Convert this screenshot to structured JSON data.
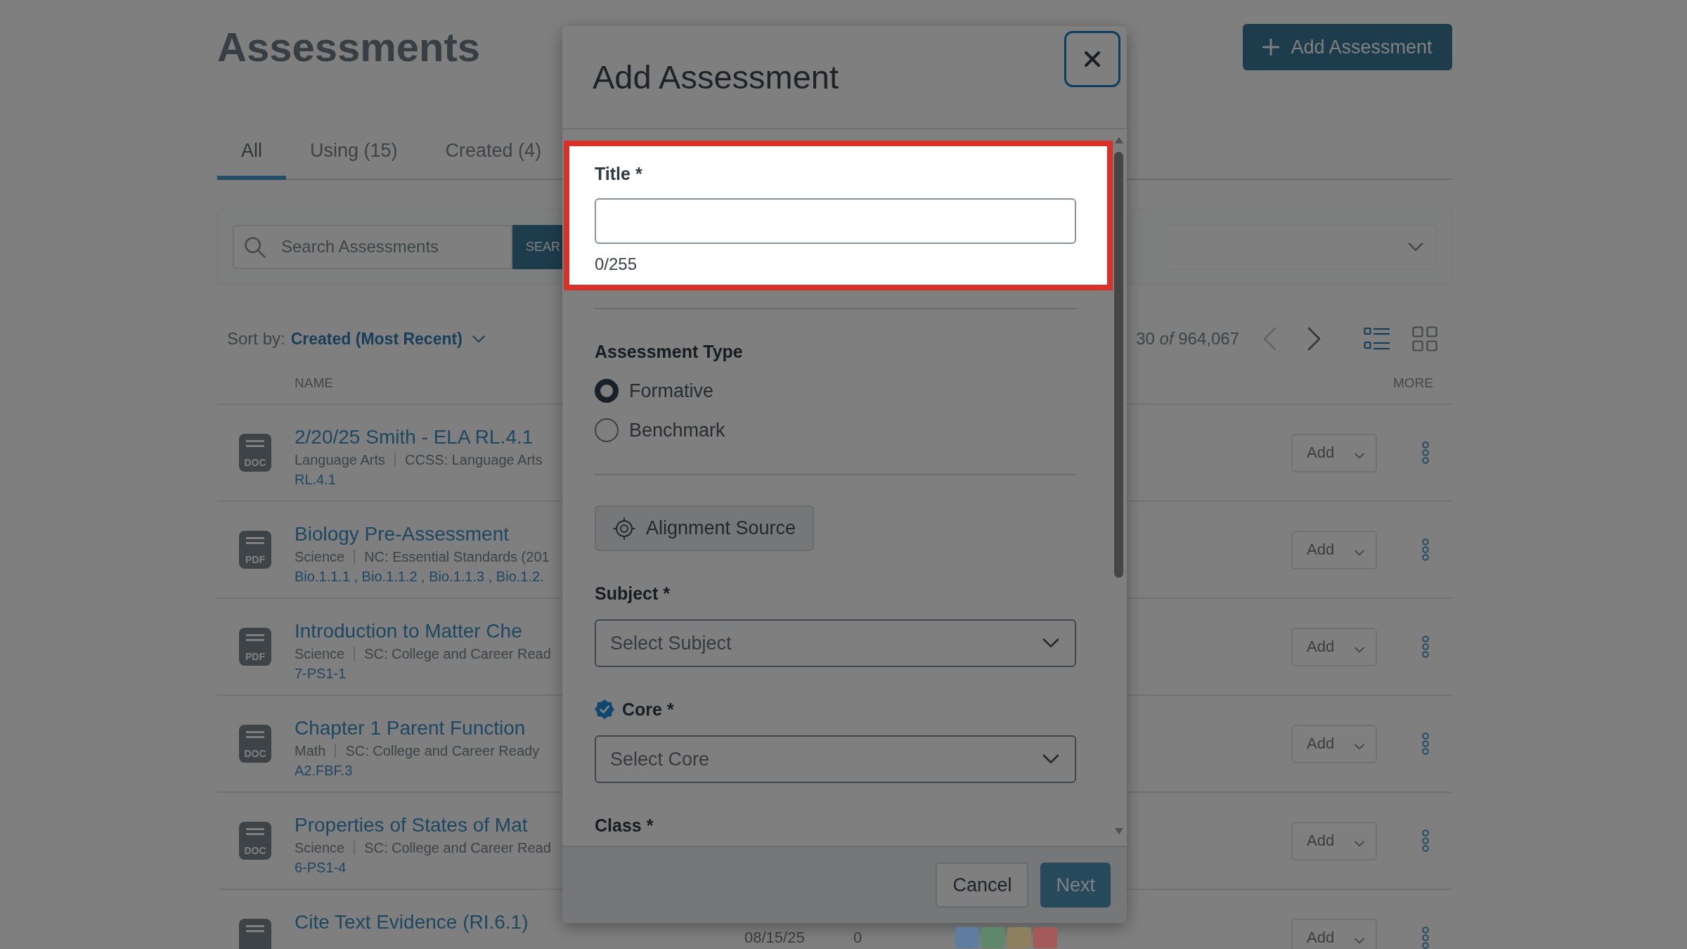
{
  "page": {
    "title": "Assessments",
    "add_button": "Add Assessment",
    "tabs": [
      {
        "label": "All",
        "selected": true
      },
      {
        "label": "Using (15)",
        "selected": false
      },
      {
        "label": "Created (4)",
        "selected": false
      }
    ],
    "search": {
      "placeholder": "Search Assessments",
      "button": "SEAR"
    },
    "sort": {
      "label": "Sort by:",
      "value": "Created (Most Recent)"
    },
    "pagination": {
      "range": "30 *of* 964,067",
      "previous": {
        "disabled": true
      },
      "next": {
        "disabled": false
      }
    },
    "views": [
      {
        "kind": "list",
        "selected": true
      },
      {
        "kind": "grid",
        "selected": false
      }
    ],
    "columns": [
      "NAME",
      "MORE"
    ],
    "rows": [
      {
        "file_type": "DOC",
        "title": "2/20/25 Smith - ELA RL.4.1",
        "subject": "Language Arts",
        "standard": "CCSS: Language Arts",
        "codes": "RL.4.1",
        "action": "Add"
      },
      {
        "file_type": "PDF",
        "title": "Biology Pre-Assessment",
        "subject": "Science",
        "standard": "NC: Essential Standards (201",
        "codes": "Bio.1.1.1 , Bio.1.1.2 , Bio.1.1.3 , Bio.1.2.",
        "action": "Add"
      },
      {
        "file_type": "PDF",
        "title": "Introduction to Matter Che",
        "subject": "Science",
        "standard": "SC: College and Career Read",
        "codes": "7-PS1-1",
        "action": "Add"
      },
      {
        "file_type": "DOC",
        "title": "Chapter 1 Parent Function",
        "subject": "Math",
        "standard": "SC: College and Career Ready",
        "codes": "A2.FBF.3",
        "action": "Add"
      },
      {
        "file_type": "DOC",
        "title": "Properties of States of Mat",
        "subject": "Science",
        "standard": "SC: College and Career Read",
        "codes": "6-PS1-4",
        "action": "Add"
      },
      {
        "title": "Cite Text Evidence (RI.6.1)",
        "date": "08/15/25",
        "count": "0",
        "tags": [
          {
            "color": "#5f7da0"
          },
          {
            "color": "#5f8769"
          },
          {
            "color": "#8c805f"
          },
          {
            "color": "#a55a5a"
          }
        ],
        "action": "Add"
      }
    ]
  },
  "dialog": {
    "title": "Add Assessment",
    "fields": [
      {
        "kind": "text",
        "label": "Title *",
        "counter": "0/255",
        "highlighted": true,
        "divider": true
      },
      {
        "kind": "radio",
        "label": "Assessment Type",
        "options": [
          {
            "label": "Formative",
            "selected": true
          },
          {
            "label": "Benchmark",
            "selected": false
          }
        ],
        "highlighted": false,
        "divider": true
      },
      {
        "kind": "button",
        "label": "Alignment Source",
        "highlighted": false,
        "divider": false
      },
      {
        "kind": "select",
        "label": "Subject *",
        "placeholder": "Select Subject",
        "verified": false,
        "highlighted": false,
        "divider": false
      },
      {
        "kind": "select",
        "label": "Core *",
        "placeholder": "Select Core",
        "verified": true,
        "highlighted": false,
        "divider": false
      },
      {
        "kind": "label",
        "label": "Class *",
        "highlighted": false,
        "divider": false
      }
    ],
    "buttons": [
      {
        "kind": "cancel",
        "label": "Cancel",
        "disabled": false
      },
      {
        "kind": "next",
        "label": "Next",
        "disabled": true
      }
    ]
  }
}
